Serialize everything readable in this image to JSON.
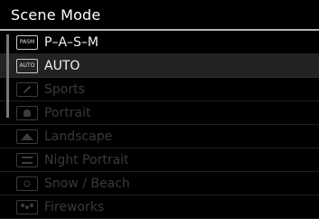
{
  "header": {
    "title": "Scene Mode"
  },
  "menu": {
    "items": [
      {
        "label": "P–A–S–M",
        "icon": "pasm-icon",
        "icon_text": "PASM",
        "state": "enabled"
      },
      {
        "label": "AUTO",
        "icon": "auto-icon",
        "icon_text": "AUTO",
        "state": "selected"
      },
      {
        "label": "Sports",
        "icon": "sports-icon",
        "icon_text": "",
        "state": "disabled"
      },
      {
        "label": "Portrait",
        "icon": "portrait-icon",
        "icon_text": "",
        "state": "disabled"
      },
      {
        "label": "Landscape",
        "icon": "landscape-icon",
        "icon_text": "",
        "state": "disabled"
      },
      {
        "label": "Night Portrait",
        "icon": "night-portrait-icon",
        "icon_text": "",
        "state": "disabled"
      },
      {
        "label": "Snow / Beach",
        "icon": "snow-beach-icon",
        "icon_text": "",
        "state": "disabled"
      },
      {
        "label": "Fireworks",
        "icon": "fireworks-icon",
        "icon_text": "",
        "state": "disabled"
      }
    ]
  },
  "colors": {
    "background": "#000000",
    "selected_row": "#232323",
    "text": "#f2f2f2",
    "disabled_text": "#3a3a3a",
    "header_rule": "#b5b5b5"
  }
}
